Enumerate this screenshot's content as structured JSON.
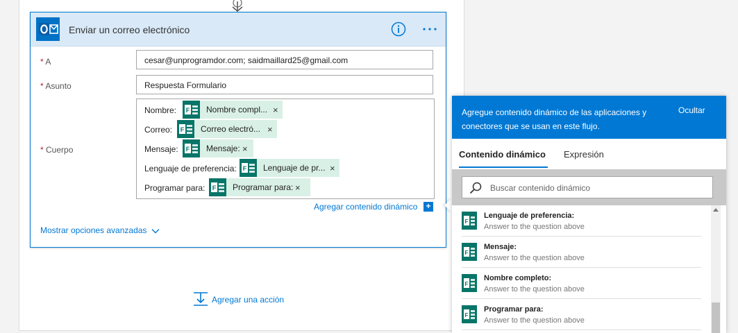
{
  "card": {
    "title": "Enviar un correo electrónico",
    "icon": "outlook-icon",
    "info_icon": "info-icon",
    "more_icon": "more-options-icon"
  },
  "fields": {
    "to": {
      "label": "A",
      "required_mark": "*",
      "value": "cesar@unprogramdor.com; saidmaillard25@gmail.com"
    },
    "subject": {
      "label": "Asunto",
      "required_mark": "*",
      "value": "Respuesta Formulario"
    },
    "body": {
      "label": "Cuerpo",
      "required_mark": "*",
      "lines": [
        {
          "label": "Nombre:",
          "token": "Nombre compl..."
        },
        {
          "label": "Correo:",
          "token": "Correo electró..."
        },
        {
          "label": "Mensaje:",
          "token": "Mensaje:"
        },
        {
          "label": "Lenguaje de preferencia:",
          "token": "Lenguaje de pr..."
        },
        {
          "label": "Programar para:",
          "token": "Programar para:"
        }
      ]
    }
  },
  "token_close": "×",
  "add_dynamic": {
    "label": "Agregar contenido dinámico",
    "button": "+"
  },
  "advanced": {
    "label": "Mostrar opciones avanzadas"
  },
  "add_action": {
    "label": "Agregar una acción"
  },
  "dynamic_panel": {
    "message": "Agregue contenido dinámico de las aplicaciones y conectores que se usan en este flujo.",
    "hide": "Ocultar",
    "tabs": [
      "Contenido dinámico",
      "Expresión"
    ],
    "active_tab": "Contenido dinámico",
    "search_placeholder": "Buscar contenido dinámico",
    "items": [
      {
        "name": "Lenguaje de preferencia:",
        "desc": "Answer to the question above"
      },
      {
        "name": "Mensaje:",
        "desc": "Answer to the question above"
      },
      {
        "name": "Nombre completo:",
        "desc": "Answer to the question above"
      },
      {
        "name": "Programar para:",
        "desc": "Answer to the question above"
      }
    ]
  },
  "colors": {
    "accent": "#0078d4",
    "forms_green": "#077568",
    "token_bg": "#d9f0e6",
    "header_bg": "#d9e9f7",
    "required": "#a4262c"
  }
}
